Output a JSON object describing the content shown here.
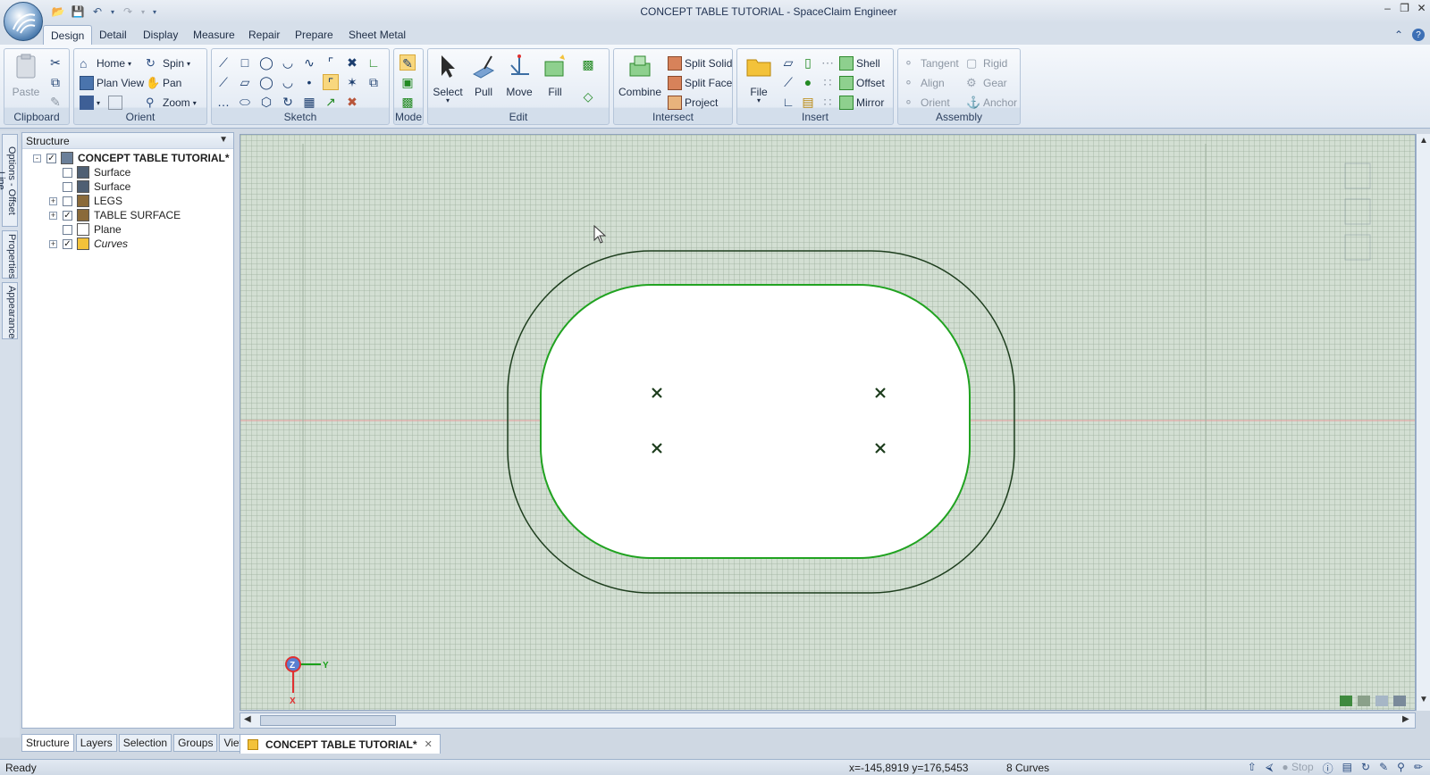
{
  "window": {
    "title": "CONCEPT TABLE TUTORIAL - SpaceClaim Engineer"
  },
  "ribbon": {
    "tabs": [
      "Design",
      "Detail",
      "Display",
      "Measure",
      "Repair",
      "Prepare",
      "Sheet Metal"
    ],
    "active_tab": "Design",
    "groups": {
      "clipboard": {
        "label": "Clipboard",
        "paste": "Paste"
      },
      "orient": {
        "label": "Orient",
        "home": "Home",
        "spin": "Spin",
        "plan_view": "Plan View",
        "pan": "Pan",
        "zoom": "Zoom"
      },
      "sketch": {
        "label": "Sketch"
      },
      "mode": {
        "label": "Mode"
      },
      "edit": {
        "label": "Edit",
        "select": "Select",
        "pull": "Pull",
        "move": "Move",
        "fill": "Fill"
      },
      "intersect": {
        "label": "Intersect",
        "combine": "Combine",
        "split_solid": "Split Solid",
        "split_face": "Split Face",
        "project": "Project"
      },
      "insert": {
        "label": "Insert",
        "file": "File",
        "shell": "Shell",
        "offset": "Offset",
        "mirror": "Mirror"
      },
      "assembly": {
        "label": "Assembly",
        "tangent": "Tangent",
        "rigid": "Rigid",
        "align": "Align",
        "gear": "Gear",
        "orient": "Orient",
        "anchor": "Anchor"
      }
    }
  },
  "side_tabs": [
    "Options - Offset Line",
    "Properties",
    "Appearance"
  ],
  "structure": {
    "title": "Structure",
    "tree": [
      {
        "label": "CONCEPT TABLE TUTORIAL*",
        "checked": true,
        "expander": "-",
        "level": 0,
        "bold": true,
        "icon": "design-icon"
      },
      {
        "label": "Surface",
        "checked": false,
        "expander": "",
        "level": 1,
        "icon": "surface-icon"
      },
      {
        "label": "Surface",
        "checked": false,
        "expander": "",
        "level": 1,
        "icon": "surface-icon"
      },
      {
        "label": "LEGS",
        "checked": false,
        "expander": "+",
        "level": 1,
        "icon": "component-icon"
      },
      {
        "label": "TABLE SURFACE",
        "checked": true,
        "expander": "+",
        "level": 1,
        "icon": "component-icon"
      },
      {
        "label": "Plane",
        "checked": false,
        "expander": "",
        "level": 1,
        "icon": "plane-icon"
      },
      {
        "label": "Curves",
        "checked": true,
        "expander": "+",
        "level": 1,
        "italic": true,
        "icon": "folder-icon"
      }
    ],
    "bottom_tabs": [
      "Structure",
      "Layers",
      "Selection",
      "Groups",
      "Views"
    ],
    "active_bottom_tab": "Structure"
  },
  "document_tab": {
    "label": "CONCEPT TABLE TUTORIAL*"
  },
  "axis_triad": {
    "z": "Z",
    "y": "Y",
    "x": "X"
  },
  "statusbar": {
    "left": "Ready",
    "coords": "x=-145,8919  y=176,5453",
    "selection": "8 Curves",
    "stop": "Stop"
  },
  "colors": {
    "canvas_bg": "#d3dfd3",
    "outer_curve": "#1d3d1d",
    "inner_curve": "#21a321",
    "axis_red": "#e03030",
    "axis_green": "#1aa01a"
  }
}
